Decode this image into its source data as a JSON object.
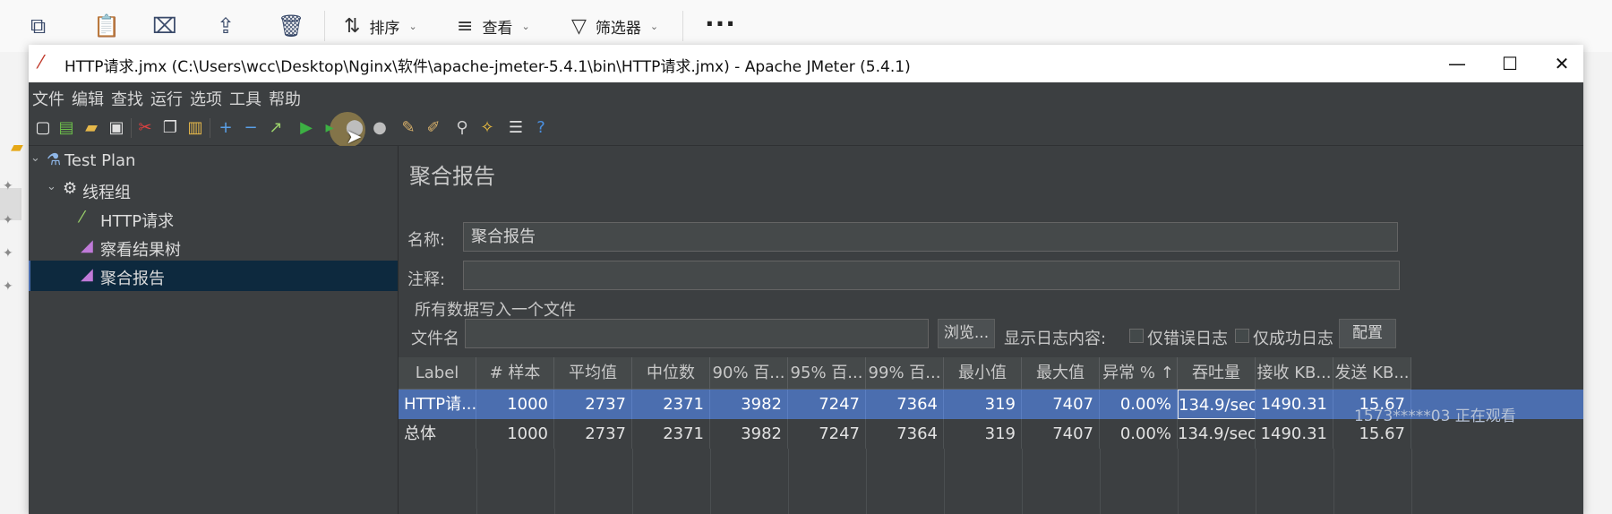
{
  "explorer": {
    "sort_label": "排序",
    "view_label": "查看",
    "filter_label": "筛选器"
  },
  "window": {
    "title": "HTTP请求.jmx (C:\\Users\\wcc\\Desktop\\Nginx\\软件\\apache-jmeter-5.4.1\\bin\\HTTP请求.jmx) - Apache JMeter (5.4.1)"
  },
  "menu": [
    "文件",
    "编辑",
    "查找",
    "运行",
    "选项",
    "工具",
    "帮助"
  ],
  "tree": {
    "test_plan": "Test Plan",
    "thread_group": "线程组",
    "http_request": "HTTP请求",
    "result_tree": "察看结果树",
    "aggregate_report": "聚合报告"
  },
  "panel": {
    "title": "聚合报告",
    "name_label": "名称:",
    "name_value": "聚合报告",
    "comment_label": "注释:",
    "comment_value": "",
    "write_all_label": "所有数据写入一个文件",
    "filename_label": "文件名",
    "filename_value": "",
    "browse_button": "浏览...",
    "log_content_label": "显示日志内容:",
    "errors_only_label": "仅错误日志",
    "success_only_label": "仅成功日志",
    "configure_button": "配置"
  },
  "table": {
    "headers": [
      "Label",
      "# 样本",
      "平均值",
      "中位数",
      "90% 百...",
      "95% 百...",
      "99% 百...",
      "最小值",
      "最大值",
      "异常 % ↑",
      "吞吐量",
      "接收 KB...",
      "发送 KB..."
    ],
    "rows": [
      [
        "HTTP请...",
        "1000",
        "2737",
        "2371",
        "3982",
        "7247",
        "7364",
        "319",
        "7407",
        "0.00%",
        "134.9/sec",
        "1490.31",
        "15.67"
      ],
      [
        "总体",
        "1000",
        "2737",
        "2371",
        "3982",
        "7247",
        "7364",
        "319",
        "7407",
        "0.00%",
        "134.9/sec",
        "1490.31",
        "15.67"
      ]
    ]
  },
  "watermark": "1573*****03 正在观看",
  "colors": {
    "jmeter_background": "#3c3f41",
    "selection": "#4b6eaf",
    "tree_selection": "#0d293e"
  }
}
